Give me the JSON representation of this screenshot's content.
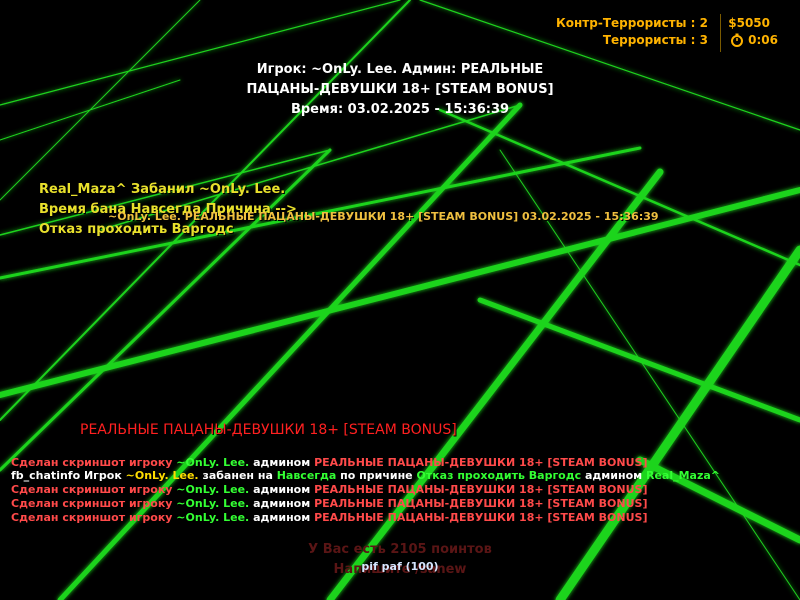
{
  "hud": {
    "ct_label": "Контр-Террористы : 2",
    "t_label": "Террористы : 3",
    "money": "$5050",
    "timer": "0:06",
    "timer_icon": "stopwatch-icon",
    "accent": "#ffb300"
  },
  "ban_info": {
    "line1": "Игрок: ~OnLy. Lee.   Админ: РЕАЛЬНЫЕ",
    "line2": "ПАЦАНЫ-ДЕВУШКИ 18+ [STEAM BONUS]",
    "line3": "Время: 03.02.2025 - 15:36:39"
  },
  "ban_notice": {
    "line1": "Real_Maza^ Забанил ~OnLy. Lee.",
    "line2": " Время  бана Навсегда Причина -->",
    "line3": "Отказ проходить Варгодс",
    "overlay": "~OnLy. Lee. РЕАЛЬНЫЕ ПАЦАНЫ-ДЕВУШКИ 18+ [STEAM BONUS] 03.02.2025 - 15:36:39"
  },
  "server_name": "РЕАЛЬНЫЕ ПАЦАНЫ-ДЕВУШКИ 18+ [STEAM BONUS]",
  "chat": [
    {
      "a": "Сделан скриншот игроку ",
      "b": "~OnLy. Lee.",
      "c": " админом ",
      "d": "РЕАЛЬНЫЕ ПАЦАНЫ-ДЕВУШКИ 18+ [STEAM BONUS]"
    },
    {
      "a": "fb_chatinfo Игрок ",
      "b": "~OnLy. Lee.",
      "c": " забанен на ",
      "d": "Навсегда",
      "e": " по причине ",
      "f": "Отказ проходить Варгодс",
      "g": " админом ",
      "h": "Real_Maza^"
    },
    {
      "a": "Сделан скриншот игроку ",
      "b": "~OnLy. Lee.",
      "c": " админом ",
      "d": "РЕАЛЬНЫЕ ПАЦАНЫ-ДЕВУШКИ 18+ [STEAM BONUS]"
    },
    {
      "a": "Сделан скриншот игроку ",
      "b": "~OnLy. Lee.",
      "c": " админом ",
      "d": "РЕАЛЬНЫЕ ПАЦАНЫ-ДЕВУШКИ 18+ [STEAM BONUS]"
    },
    {
      "a": "Сделан скриншот игроку ",
      "b": "~OnLy. Lee.",
      "c": " админом ",
      "d": "РЕАЛЬНЫЕ ПАЦАНЫ-ДЕВУШКИ 18+ [STEAM BONUS]"
    }
  ],
  "points_text": "У Вас есть 2105 поинтов",
  "hint_text": "Напишите /sanew",
  "chat_input": "pif paf (100)",
  "grid_color": "#18c818"
}
